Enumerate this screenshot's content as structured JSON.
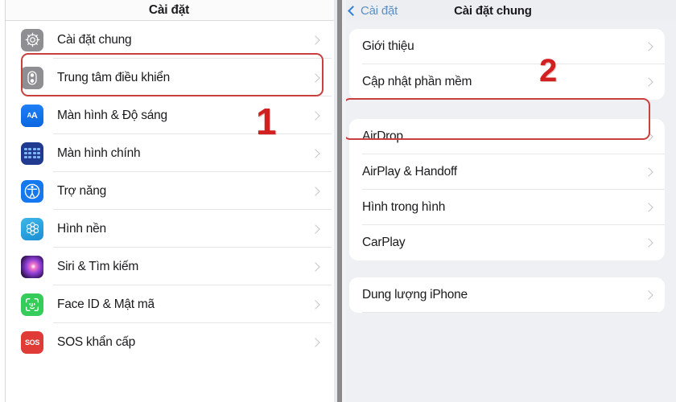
{
  "left_screen": {
    "navbar": {
      "title": "Cài đặt"
    },
    "items": [
      {
        "label": "Cài đặt chung",
        "icon": "gear-icon"
      },
      {
        "label": "Trung tâm điều khiển",
        "icon": "control-center-icon"
      },
      {
        "label": "Màn hình & Độ sáng",
        "icon": "display-brightness-icon"
      },
      {
        "label": "Màn hình chính",
        "icon": "home-screen-icon"
      },
      {
        "label": "Trợ năng",
        "icon": "accessibility-icon"
      },
      {
        "label": "Hình nền",
        "icon": "wallpaper-icon"
      },
      {
        "label": "Siri & Tìm kiếm",
        "icon": "siri-icon"
      },
      {
        "label": "Face ID & Mật mã",
        "icon": "face-id-icon"
      },
      {
        "label": "SOS khẩn cấp",
        "icon": "sos-icon"
      }
    ]
  },
  "right_screen": {
    "navbar": {
      "back_label": "Cài đặt",
      "title": "Cài đặt chung"
    },
    "group_1": [
      {
        "label": "Giới thiệu"
      },
      {
        "label": "Cập nhật phần mềm"
      }
    ],
    "group_2": [
      {
        "label": "AirDrop"
      },
      {
        "label": "AirPlay & Handoff"
      },
      {
        "label": "Hình trong hình"
      },
      {
        "label": "CarPlay"
      }
    ],
    "group_3": [
      {
        "label": "Dung lượng iPhone"
      }
    ]
  },
  "annotations": {
    "step_1": "1",
    "step_2": "2",
    "highlight_color": "#c9403f",
    "marker_color": "#d21f1f"
  },
  "icon_labels": {
    "aa_big": "A",
    "aa_small": "A",
    "sos": "SOS"
  }
}
